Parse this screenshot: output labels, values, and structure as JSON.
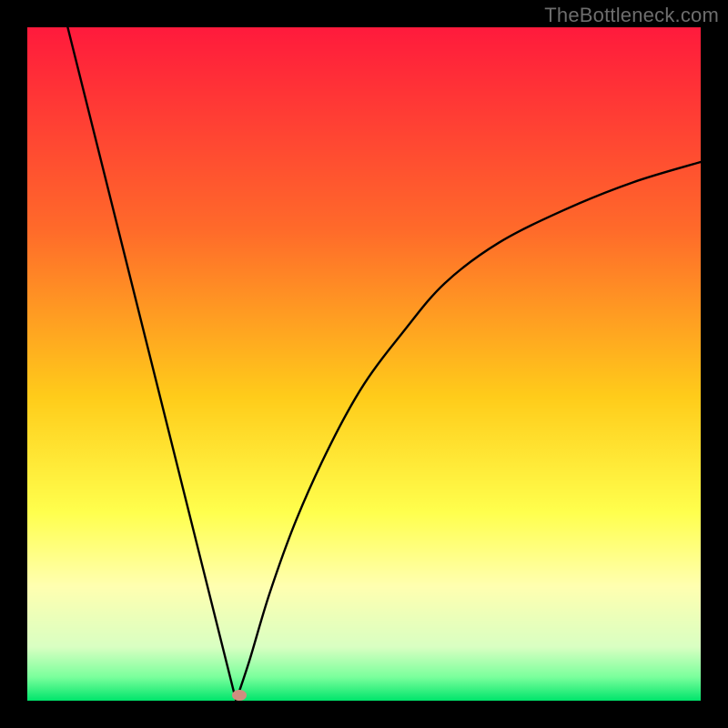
{
  "watermark": {
    "text": "TheBottleneck.com"
  },
  "chart_data": {
    "type": "line",
    "title": "",
    "xlabel": "",
    "ylabel": "",
    "xlim": [
      0,
      100
    ],
    "ylim": [
      0,
      100
    ],
    "grid": false,
    "legend": false,
    "gradient_stops": [
      {
        "offset": 0.0,
        "color": "#ff1a3c"
      },
      {
        "offset": 0.3,
        "color": "#ff6a2a"
      },
      {
        "offset": 0.55,
        "color": "#ffcc1a"
      },
      {
        "offset": 0.72,
        "color": "#ffff4d"
      },
      {
        "offset": 0.83,
        "color": "#ffffb0"
      },
      {
        "offset": 0.92,
        "color": "#d9ffc2"
      },
      {
        "offset": 0.965,
        "color": "#7aff9c"
      },
      {
        "offset": 1.0,
        "color": "#00e56b"
      }
    ],
    "curve": {
      "minimum_x": 31,
      "minimum_y": 0,
      "left_endpoint": {
        "x": 6,
        "y": 100
      },
      "right_endpoint": {
        "x": 100,
        "y": 80
      },
      "points": [
        {
          "x": 6,
          "y": 100
        },
        {
          "x": 10,
          "y": 84
        },
        {
          "x": 14,
          "y": 68
        },
        {
          "x": 18,
          "y": 52
        },
        {
          "x": 22,
          "y": 36
        },
        {
          "x": 26,
          "y": 20
        },
        {
          "x": 29,
          "y": 8
        },
        {
          "x": 31,
          "y": 0
        },
        {
          "x": 33,
          "y": 6
        },
        {
          "x": 36,
          "y": 16
        },
        {
          "x": 40,
          "y": 27
        },
        {
          "x": 45,
          "y": 38
        },
        {
          "x": 50,
          "y": 47
        },
        {
          "x": 56,
          "y": 55
        },
        {
          "x": 62,
          "y": 62
        },
        {
          "x": 70,
          "y": 68
        },
        {
          "x": 80,
          "y": 73
        },
        {
          "x": 90,
          "y": 77
        },
        {
          "x": 100,
          "y": 80
        }
      ]
    },
    "marker": {
      "x": 31.5,
      "y": 0.8,
      "color": "#cf8d7f"
    }
  }
}
